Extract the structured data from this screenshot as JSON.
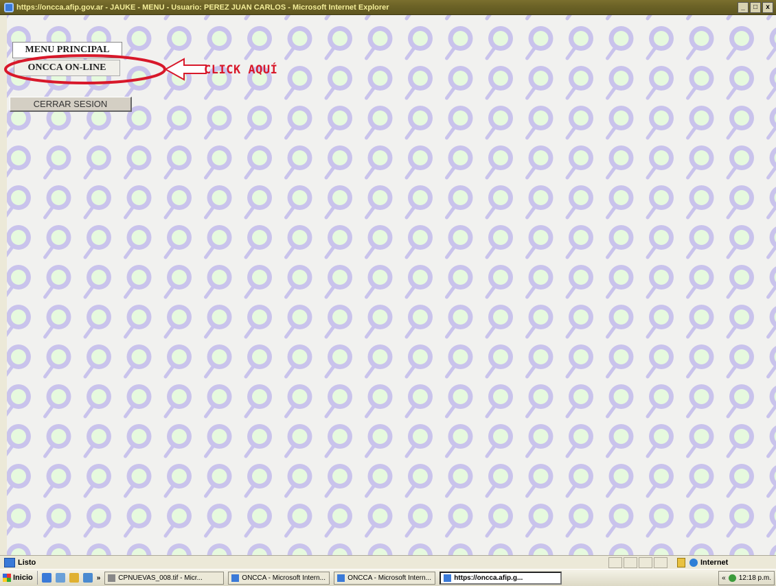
{
  "window": {
    "title": "https://oncca.afip.gov.ar - JAUKE - MENU - Usuario: PEREZ JUAN CARLOS - Microsoft Internet Explorer",
    "controls": [
      "_",
      "□",
      "x"
    ]
  },
  "menu": {
    "principal_label": "MENU PRINCIPAL",
    "online_label": "ONCCA ON-LINE",
    "logout_label": "CERRAR SESION"
  },
  "annotation": {
    "text": "CLICK AQUÍ",
    "color": "#d8182a"
  },
  "statusbar": {
    "text": "Listo",
    "zone": "Internet"
  },
  "taskbar": {
    "start_label": "Inicio",
    "overflow": "»",
    "tasks": [
      "CPNUEVAS_008.tif - Micr...",
      "ONCCA - Microsoft Intern...",
      "ONCCA - Microsoft Intern...",
      "https://oncca.afip.g..."
    ],
    "tray_chevron": "«",
    "clock": "12:18 p.m."
  },
  "colors": {
    "title_bar": "#6b6226",
    "pattern_ring": "#c9c3ec",
    "pattern_fill": "#e6f9de",
    "page_bg": "#f1f1ef"
  }
}
